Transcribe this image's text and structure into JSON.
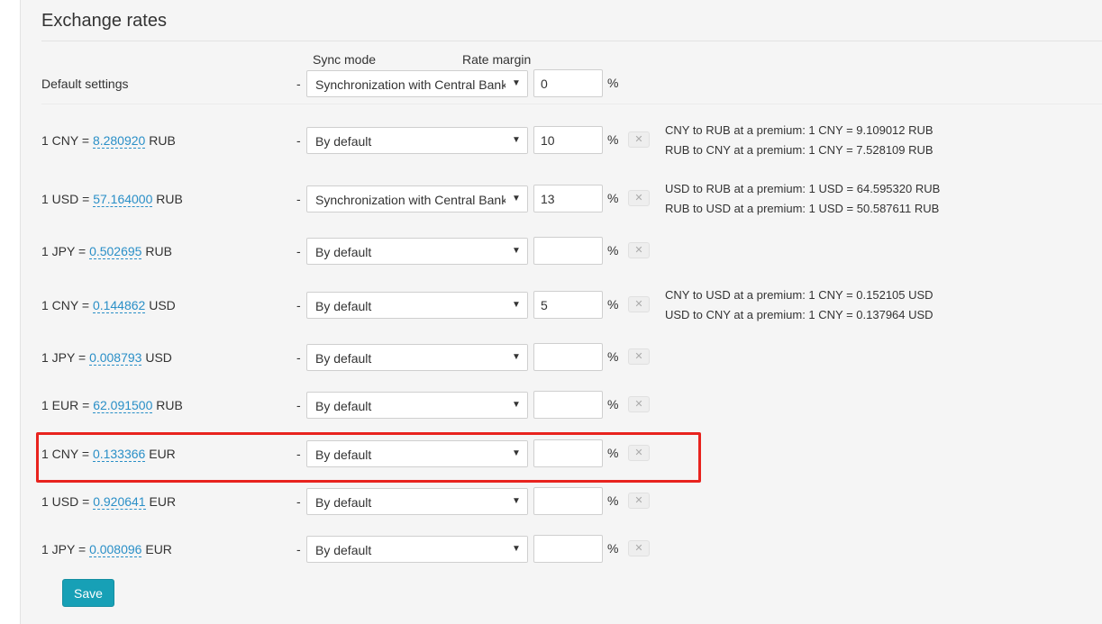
{
  "page": {
    "title": "Exchange rates",
    "sync_mode_header": "Sync mode",
    "rate_margin_header": "Rate margin",
    "dash": "-",
    "percent": "%",
    "remove_glyph": "✕",
    "chevron_glyph": "▼",
    "save_label": "Save"
  },
  "default_settings": {
    "label": "Default settings",
    "sync_mode": "Synchronization with Central Bank",
    "margin": "0"
  },
  "rows": [
    {
      "prefix": "1 CNY = ",
      "rate": "8.280920",
      "suffix": " RUB",
      "sync_mode": "By default",
      "margin": "10",
      "premium_line1": "CNY to RUB at a premium: 1 CNY = 9.109012 RUB",
      "premium_line2": "RUB to CNY at a premium: 1 CNY = 7.528109 RUB"
    },
    {
      "prefix": "1 USD = ",
      "rate": "57.164000",
      "suffix": " RUB",
      "sync_mode": "Synchronization with Central Bank",
      "margin": "13",
      "premium_line1": "USD to RUB at a premium: 1 USD = 64.595320 RUB",
      "premium_line2": "RUB to USD at a premium: 1 USD = 50.587611 RUB"
    },
    {
      "prefix": "1 JPY = ",
      "rate": "0.502695",
      "suffix": " RUB",
      "sync_mode": "By default",
      "margin": "",
      "premium_line1": "",
      "premium_line2": ""
    },
    {
      "prefix": "1 CNY = ",
      "rate": "0.144862",
      "suffix": " USD",
      "sync_mode": "By default",
      "margin": "5",
      "premium_line1": "CNY to USD at a premium: 1 CNY = 0.152105 USD",
      "premium_line2": "USD to CNY at a premium: 1 CNY = 0.137964 USD"
    },
    {
      "prefix": "1 JPY = ",
      "rate": "0.008793",
      "suffix": " USD",
      "sync_mode": "By default",
      "margin": "",
      "premium_line1": "",
      "premium_line2": ""
    },
    {
      "prefix": "1 EUR = ",
      "rate": "62.091500",
      "suffix": " RUB",
      "sync_mode": "By default",
      "margin": "",
      "premium_line1": "",
      "premium_line2": ""
    },
    {
      "prefix": "1 CNY = ",
      "rate": "0.133366",
      "suffix": " EUR",
      "sync_mode": "By default",
      "margin": "",
      "premium_line1": "",
      "premium_line2": ""
    },
    {
      "prefix": "1 USD = ",
      "rate": "0.920641",
      "suffix": " EUR",
      "sync_mode": "By default",
      "margin": "",
      "premium_line1": "",
      "premium_line2": ""
    },
    {
      "prefix": "1 JPY = ",
      "rate": "0.008096",
      "suffix": " EUR",
      "sync_mode": "By default",
      "margin": "",
      "premium_line1": "",
      "premium_line2": ""
    }
  ],
  "colors": {
    "link": "#2a8fc7",
    "save_button": "#17a0b6",
    "highlight_border": "#e8231e"
  }
}
